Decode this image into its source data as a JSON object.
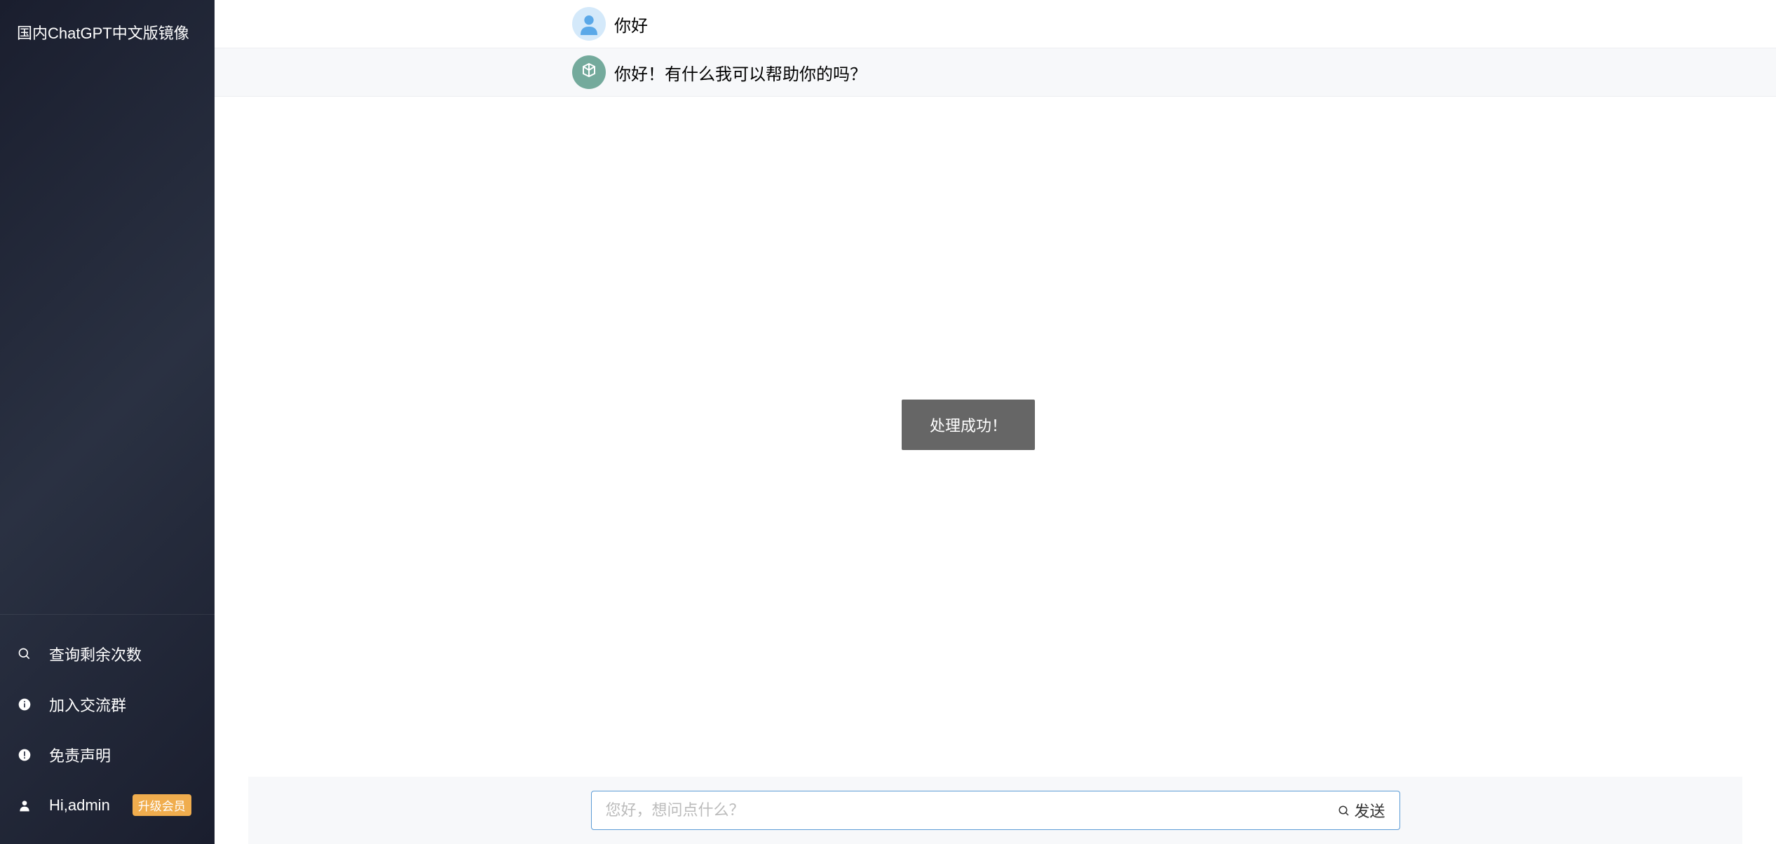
{
  "sidebar": {
    "title": "国内ChatGPT中文版镜像",
    "menu": {
      "query": "查询剩余次数",
      "group": "加入交流群",
      "disclaimer": "免责声明",
      "user_greeting": "Hi,admin",
      "upgrade_badge": "升级会员"
    }
  },
  "chat": {
    "messages": [
      {
        "role": "user",
        "text": "你好"
      },
      {
        "role": "assistant",
        "text": "你好！有什么我可以帮助你的吗？"
      }
    ]
  },
  "toast": {
    "text": "处理成功！"
  },
  "input": {
    "placeholder": "您好，想问点什么？",
    "send_label": "发送"
  }
}
